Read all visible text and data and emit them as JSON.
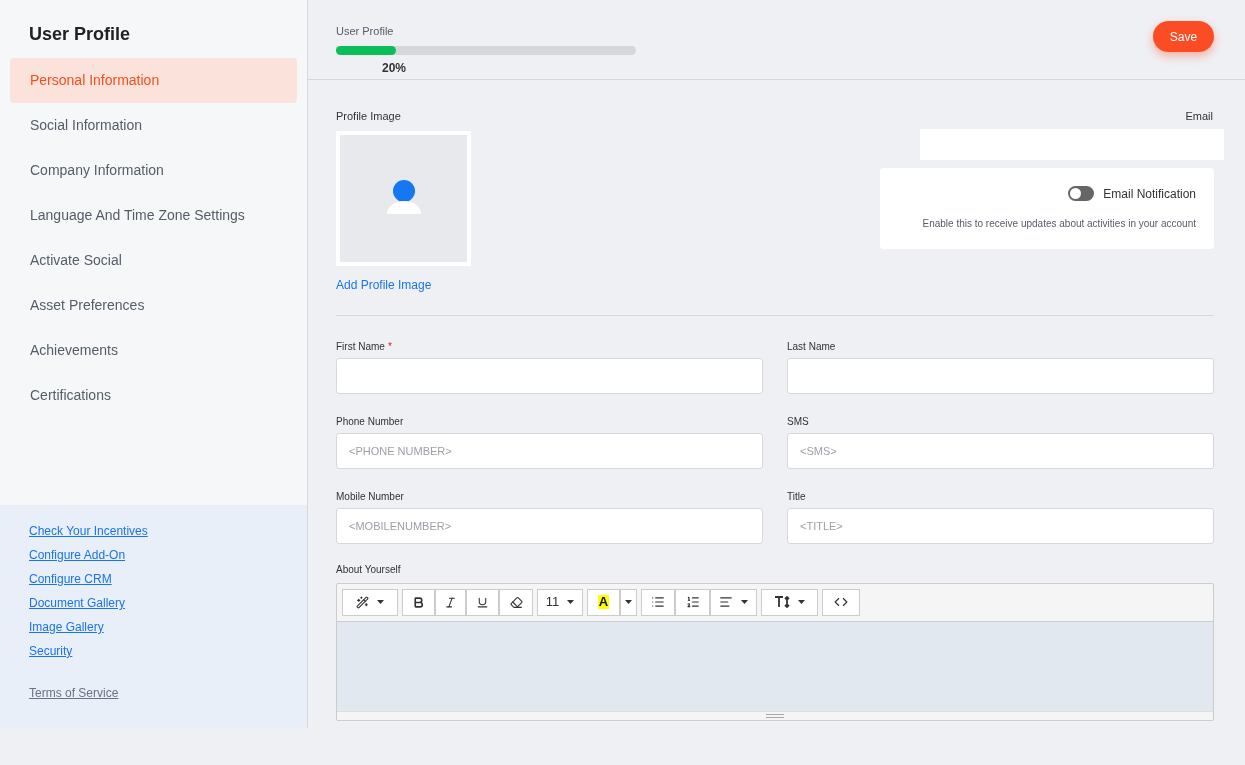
{
  "sidebar": {
    "title": "User Profile",
    "items": [
      {
        "label": "Personal Information",
        "selected": true
      },
      {
        "label": "Social Information",
        "selected": false
      },
      {
        "label": "Company Information",
        "selected": false
      },
      {
        "label": "Language And Time Zone Settings",
        "selected": false
      },
      {
        "label": "Activate Social",
        "selected": false
      },
      {
        "label": "Asset Preferences",
        "selected": false
      },
      {
        "label": "Achievements",
        "selected": false
      },
      {
        "label": "Certifications",
        "selected": false
      }
    ],
    "links": [
      "Check Your Incentives",
      "Configure Add-On",
      "Configure CRM",
      "Document Gallery",
      "Image Gallery",
      "Security"
    ],
    "terms": "Terms of Service"
  },
  "header": {
    "title": "User Profile",
    "progress": {
      "level": 0.2,
      "reading": "20%"
    },
    "save": "Save"
  },
  "profile_image": {
    "label": "Profile Image",
    "add": "Add Profile Image"
  },
  "email": {
    "label": "Email"
  },
  "email_notification": {
    "label": "Email Notification",
    "on": false,
    "hint": "Enable this to receive updates about activities in your account"
  },
  "fields": [
    {
      "label": "First Name",
      "required_mark": "*"
    },
    {
      "label": "Last Name"
    },
    {
      "label": "Phone Number",
      "placeholder": "<PHONE NUMBER>"
    },
    {
      "label": "SMS",
      "placeholder": "<SMS>"
    },
    {
      "label": "Mobile Number",
      "placeholder": "<MOBILENUMBER>"
    },
    {
      "label": "Title",
      "placeholder": "<TITLE>"
    }
  ],
  "about": {
    "label": "About Yourself",
    "font_size": "11",
    "highlight": "A"
  }
}
